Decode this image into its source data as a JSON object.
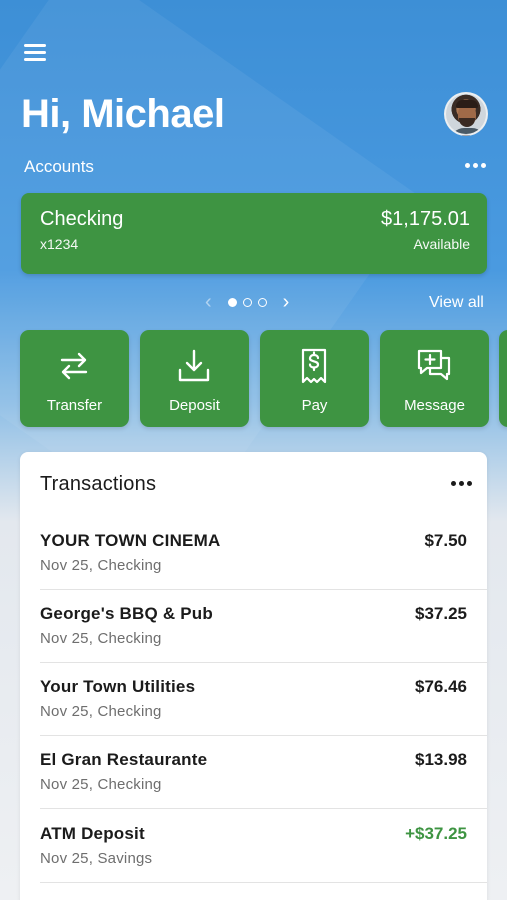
{
  "header": {
    "greeting": "Hi, Michael",
    "accounts_label": "Accounts"
  },
  "account": {
    "name": "Checking",
    "number": "x1234",
    "balance": "$1,175.01",
    "balance_label": "Available"
  },
  "pager": {
    "pages": 3,
    "active_index": 0,
    "view_all": "View all"
  },
  "actions": [
    {
      "label": "Transfer",
      "icon": "transfer-icon"
    },
    {
      "label": "Deposit",
      "icon": "deposit-icon"
    },
    {
      "label": "Pay",
      "icon": "pay-icon"
    },
    {
      "label": "Message",
      "icon": "message-icon"
    }
  ],
  "transactions": {
    "title": "Transactions",
    "items": [
      {
        "name": "YOUR TOWN CINEMA",
        "meta": "Nov 25, Checking",
        "amount": "$7.50",
        "type": "debit"
      },
      {
        "name": "George's BBQ & Pub",
        "meta": "Nov 25, Checking",
        "amount": "$37.25",
        "type": "debit"
      },
      {
        "name": "Your Town Utilities",
        "meta": "Nov 25, Checking",
        "amount": "$76.46",
        "type": "debit"
      },
      {
        "name": "El Gran Restaurante",
        "meta": "Nov 25, Checking",
        "amount": "$13.98",
        "type": "debit"
      },
      {
        "name": "ATM Deposit",
        "meta": "Nov 25, Savings",
        "amount": "+$37.25",
        "type": "credit"
      }
    ]
  },
  "colors": {
    "brand_green": "#3e9442",
    "header_blue": "#3d8fd6",
    "credit_green": "#3e9442"
  }
}
